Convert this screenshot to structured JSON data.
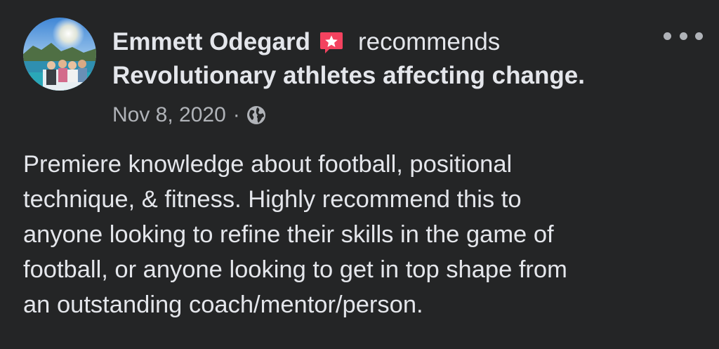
{
  "post": {
    "author": "Emmett Odegard",
    "action_text": "recommends",
    "page_name": "Revolutionary athletes affecting change.",
    "date": "Nov 8, 2020",
    "separator": "·",
    "privacy_icon": "globe-icon",
    "recommend_icon": "recommendation-star-icon",
    "more_icon": "more-options-icon",
    "body_lines": [
      "Premiere knowledge about football, positional",
      "technique, & fitness. Highly recommend this to",
      "anyone looking to refine their skills in the game of",
      "football, or anyone looking to get in top shape from",
      "an outstanding coach/mentor/person."
    ]
  },
  "colors": {
    "background": "#242526",
    "primary_text": "#e4e6eb",
    "secondary_text": "#b0b3b8",
    "recommend_badge": "#f3425f"
  }
}
